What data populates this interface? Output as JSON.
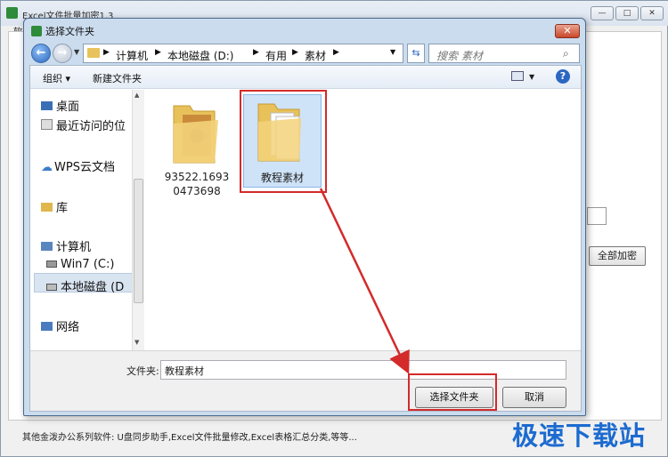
{
  "main": {
    "title": "Excel文件批量加密1.3",
    "menu_fragment": "软",
    "encrypt_all_button": "全部加密",
    "bottom_text": "其他金泼办公系列软件: U盘同步助手,Excel文件批量修改,Excel表格汇总分类,等等...",
    "watermark": "极速下载站"
  },
  "dialog": {
    "title": "选择文件夹",
    "breadcrumb": [
      "计算机",
      "本地磁盘 (D:)",
      "有用",
      "素材"
    ],
    "search_placeholder": "搜索 素材",
    "toolbar": {
      "organize": "组织 ▾",
      "new_folder": "新建文件夹"
    },
    "nav_items": [
      {
        "label": "桌面",
        "icon": "desktop-icon"
      },
      {
        "label": "最近访问的位",
        "icon": "recent-icon"
      },
      {
        "label": "WPS云文档",
        "icon": "cloud-icon"
      },
      {
        "label": "库",
        "icon": "library-icon"
      },
      {
        "label": "计算机",
        "icon": "computer-icon"
      },
      {
        "label": "Win7 (C:)",
        "icon": "drive-icon"
      },
      {
        "label": "本地磁盘 (D",
        "icon": "drive-icon"
      },
      {
        "label": "网络",
        "icon": "network-icon"
      }
    ],
    "folders": [
      {
        "name": "93522.16930473698",
        "name_lines": [
          "93522.1693",
          "0473698"
        ]
      },
      {
        "name": "教程素材",
        "name_lines": [
          "教程素材"
        ]
      }
    ],
    "folder_label": "文件夹:",
    "folder_value": "教程素材",
    "select_button": "选择文件夹",
    "cancel_button": "取消"
  },
  "colors": {
    "accent_red": "#d42a2a",
    "watermark_blue": "#1c6bd0"
  }
}
